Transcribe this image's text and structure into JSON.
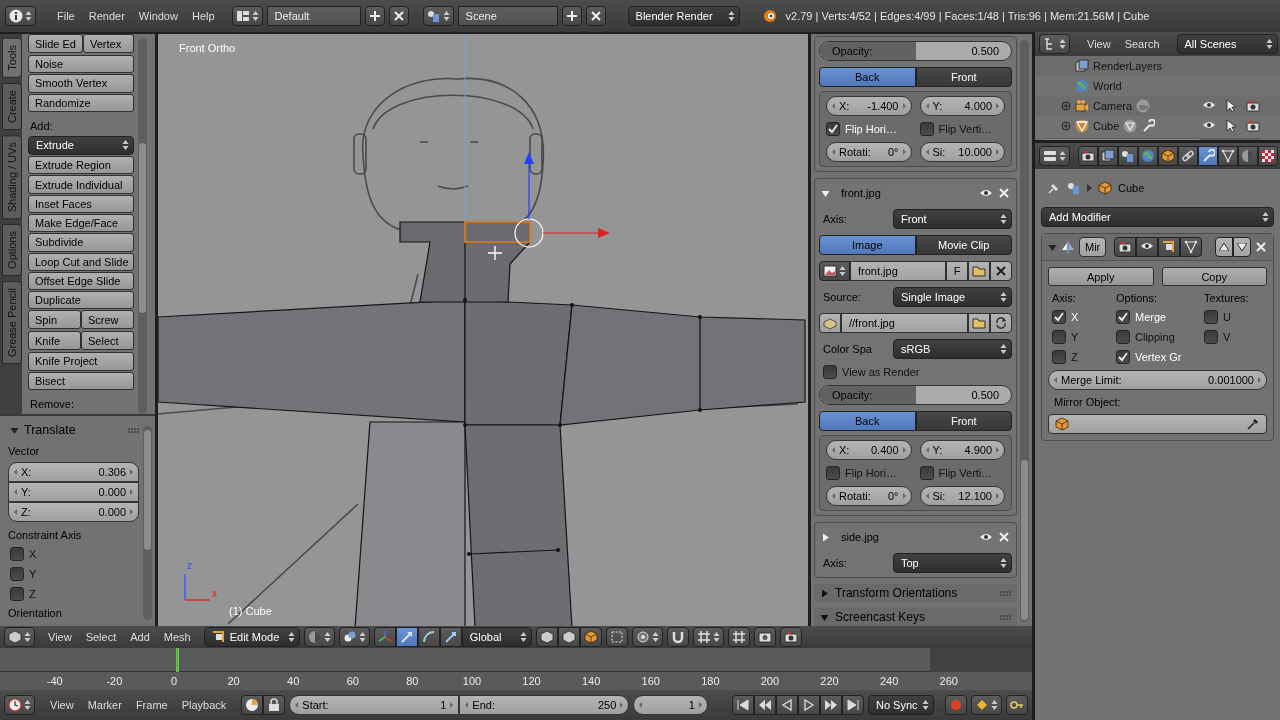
{
  "top_bar": {
    "menus": [
      "File",
      "Render",
      "Window",
      "Help"
    ],
    "screen_layout": "Default",
    "scene": "Scene",
    "render_engine": "Blender Render",
    "stats": "v2.79 | Verts:4/52 | Edges:4/99 | Faces:1/48 | Tris:96 | Mem:21.56M | Cube"
  },
  "tool_tabs": [
    {
      "label": "Tools",
      "selected": true
    },
    {
      "label": "Create",
      "selected": false
    },
    {
      "label": "Shading / UVs",
      "selected": false
    },
    {
      "label": "Options",
      "selected": false
    },
    {
      "label": "Grease Pencil",
      "selected": false
    }
  ],
  "tool_shelf": [
    {
      "kind": "pair",
      "labels": [
        "Slide Ed",
        "Vertex"
      ]
    },
    {
      "kind": "button",
      "label": "Noise"
    },
    {
      "kind": "button",
      "label": "Smooth Vertex"
    },
    {
      "kind": "button",
      "label": "Randomize"
    },
    {
      "kind": "heading",
      "label": "Add:"
    },
    {
      "kind": "dropdown",
      "label": "Extrude"
    },
    {
      "kind": "button",
      "label": "Extrude Region"
    },
    {
      "kind": "button",
      "label": "Extrude Individual"
    },
    {
      "kind": "button",
      "label": "Inset Faces"
    },
    {
      "kind": "button",
      "label": "Make Edge/Face"
    },
    {
      "kind": "button",
      "label": "Subdivide"
    },
    {
      "kind": "button",
      "label": "Loop Cut and Slide"
    },
    {
      "kind": "button",
      "label": "Offset Edge Slide"
    },
    {
      "kind": "button",
      "label": "Duplicate"
    },
    {
      "kind": "pair",
      "labels": [
        "Spin",
        "Screw"
      ]
    },
    {
      "kind": "pair",
      "labels": [
        "Knife",
        "Select"
      ]
    },
    {
      "kind": "button",
      "label": "Knife Project"
    },
    {
      "kind": "button",
      "label": "Bisect"
    },
    {
      "kind": "heading",
      "label": "Remove:"
    }
  ],
  "operator_panel": {
    "title": "Translate",
    "expanded": true,
    "vector_label": "Vector",
    "vector": [
      {
        "label": "X:",
        "value": "0.306"
      },
      {
        "label": "Y:",
        "value": "0.000"
      },
      {
        "label": "Z:",
        "value": "0.000"
      }
    ],
    "constraint_label": "Constraint Axis",
    "constraints": [
      {
        "label": "X",
        "checked": false
      },
      {
        "label": "Y",
        "checked": false
      },
      {
        "label": "Z",
        "checked": false
      }
    ],
    "next_label": "Orientation"
  },
  "viewport": {
    "view_name": "Front Ortho",
    "object_info": "(1) Cube",
    "axis_labels": [
      "z",
      "x"
    ]
  },
  "n_panel": {
    "partial_image": {
      "opacity_label": "Opacity:",
      "opacity": "0.500",
      "level": 0.5,
      "sides": [
        {
          "label": "Back",
          "selected": true
        },
        {
          "label": "Front",
          "selected": false
        }
      ],
      "offsets": [
        {
          "label": "X:",
          "value": "-1.400"
        },
        {
          "label": "Y:",
          "value": "4.000"
        }
      ],
      "flips": [
        {
          "label": "Flip Hori…",
          "checked": true
        },
        {
          "label": "Flip Verti…",
          "checked": false
        }
      ],
      "transform": [
        {
          "label": "Rotati:",
          "value": "0°"
        },
        {
          "label": "Si:",
          "value": "10.000"
        }
      ]
    },
    "images": [
      {
        "name": "front.jpg",
        "expanded": true,
        "axis_label": "Axis:",
        "axis": "Front",
        "sources": [
          {
            "label": "Image",
            "selected": true
          },
          {
            "label": "Movie Clip",
            "selected": false
          }
        ],
        "image_name": "front.jpg",
        "fake_user": "F",
        "source_label": "Source:",
        "source": "Single Image",
        "path": "//front.jpg",
        "color_space_label": "Color Spa",
        "color_space": "sRGB",
        "view_as_render": {
          "label": "View as Render",
          "checked": false
        },
        "placement": {
          "opacity_label": "Opacity:",
          "opacity": "0.500",
          "level": 0.5,
          "sides": [
            {
              "label": "Back",
              "selected": true
            },
            {
              "label": "Front",
              "selected": false
            }
          ],
          "offsets": [
            {
              "label": "X:",
              "value": "0.400"
            },
            {
              "label": "Y:",
              "value": "4.900"
            }
          ],
          "flips": [
            {
              "label": "Flip Hori…",
              "checked": false
            },
            {
              "label": "Flip Verti…",
              "checked": false
            }
          ],
          "transform": [
            {
              "label": "Rotati:",
              "value": "0°"
            },
            {
              "label": "Si:",
              "value": "12.100"
            }
          ]
        }
      },
      {
        "name": "side.jpg",
        "expanded": false,
        "axis_label": "Axis:",
        "axis": "Top"
      }
    ],
    "panels": [
      {
        "title": "Transform Orientations",
        "expanded": false
      },
      {
        "title": "Screencast Keys",
        "expanded": true
      }
    ]
  },
  "outliner": {
    "menus": [
      "View",
      "Search"
    ],
    "filter": "All Scenes",
    "rows": [
      {
        "kind": "render_layers",
        "label": "RenderLayers",
        "expandable": false
      },
      {
        "kind": "world",
        "label": "World",
        "expandable": false
      },
      {
        "kind": "camera",
        "label": "Camera",
        "expandable": true
      },
      {
        "kind": "mesh",
        "label": "Cube",
        "expandable": true
      }
    ]
  },
  "properties": {
    "tabs": [
      {
        "kind": "render",
        "selected": false
      },
      {
        "kind": "render_layers",
        "selected": false
      },
      {
        "kind": "scene",
        "selected": false
      },
      {
        "kind": "world",
        "selected": false
      },
      {
        "kind": "object",
        "selected": false
      },
      {
        "kind": "constraints",
        "selected": false
      },
      {
        "kind": "modifiers",
        "selected": true
      },
      {
        "kind": "data",
        "selected": false
      },
      {
        "kind": "material",
        "selected": false
      },
      {
        "kind": "texture",
        "selected": false
      }
    ],
    "object_name": "Cube",
    "add_modifier": "Add Modifier",
    "modifier": {
      "expanded": true,
      "name": "Mir",
      "apply": "Apply",
      "copy": "Copy",
      "columns": [
        {
          "heading": "Axis:",
          "options": [
            {
              "label": "X",
              "checked": true
            },
            {
              "label": "Y",
              "checked": false
            },
            {
              "label": "Z",
              "checked": false
            }
          ]
        },
        {
          "heading": "Options:",
          "options": [
            {
              "label": "Merge",
              "checked": true
            },
            {
              "label": "Clipping",
              "checked": false
            },
            {
              "label": "Vertex Gr",
              "checked": true
            }
          ]
        },
        {
          "heading": "Textures:",
          "options": [
            {
              "label": "U",
              "checked": false
            },
            {
              "label": "V",
              "checked": false
            }
          ]
        }
      ],
      "merge_limit_label": "Merge Limit:",
      "merge_limit": "0.001000",
      "mirror_object_label": "Mirror Object:"
    }
  },
  "view_header": {
    "menus": [
      "View",
      "Select",
      "Add",
      "Mesh"
    ],
    "mode": "Edit Mode",
    "manipulators": [
      {
        "kind": "axes",
        "selected": false
      },
      {
        "kind": "translate",
        "selected": true
      },
      {
        "kind": "rotate",
        "selected": false
      },
      {
        "kind": "scale",
        "selected": false
      }
    ],
    "orientation": "Global"
  },
  "timeline": {
    "ticks": [
      "-40",
      "-20",
      "0",
      "20",
      "40",
      "60",
      "80",
      "100",
      "120",
      "140",
      "160",
      "180",
      "200",
      "220",
      "240",
      "260"
    ]
  },
  "timeline_header": {
    "menus": [
      "View",
      "Marker",
      "Frame",
      "Playback"
    ],
    "start_label": "Start:",
    "start": "1",
    "end_label": "End:",
    "end": "250",
    "current_frame": "1",
    "sync": "No Sync"
  }
}
